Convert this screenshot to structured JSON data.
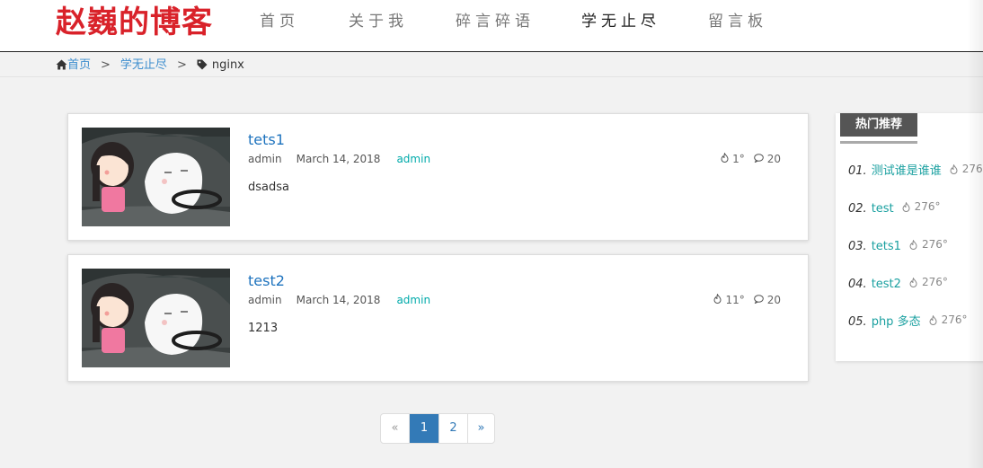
{
  "header": {
    "logo": "赵巍的博客",
    "nav": [
      "首页",
      "关于我",
      "碎言碎语",
      "学无止尽",
      "留言板"
    ]
  },
  "breadcrumb": {
    "home": "首页",
    "section": "学无止尽",
    "separator": ">",
    "tag": "nginx"
  },
  "posts": [
    {
      "title": "tets1",
      "author": "admin",
      "date": "March 14, 2018",
      "category": "admin",
      "views": "1°",
      "comments": "20",
      "summary": "dsadsa"
    },
    {
      "title": "test2",
      "author": "admin",
      "date": "March 14, 2018",
      "category": "admin",
      "views": "11°",
      "comments": "20",
      "summary": "1213"
    }
  ],
  "pagination": {
    "prev": "«",
    "pages": [
      "1",
      "2"
    ],
    "next": "»",
    "current": "1"
  },
  "sidebar": {
    "title": "热门推荐",
    "items": [
      {
        "num": "01.",
        "label": "测试谁是谁谁",
        "hot": "276"
      },
      {
        "num": "02.",
        "label": "test",
        "hot": "276°"
      },
      {
        "num": "03.",
        "label": "tets1",
        "hot": "276°"
      },
      {
        "num": "04.",
        "label": "test2",
        "hot": "276°"
      },
      {
        "num": "05.",
        "label": "php 多态",
        "hot": "276°"
      }
    ]
  },
  "colors": {
    "logo": "#d9222a",
    "link": "#1e73be",
    "accent": "#1aa0a0",
    "pager_active": "#337ab7"
  }
}
